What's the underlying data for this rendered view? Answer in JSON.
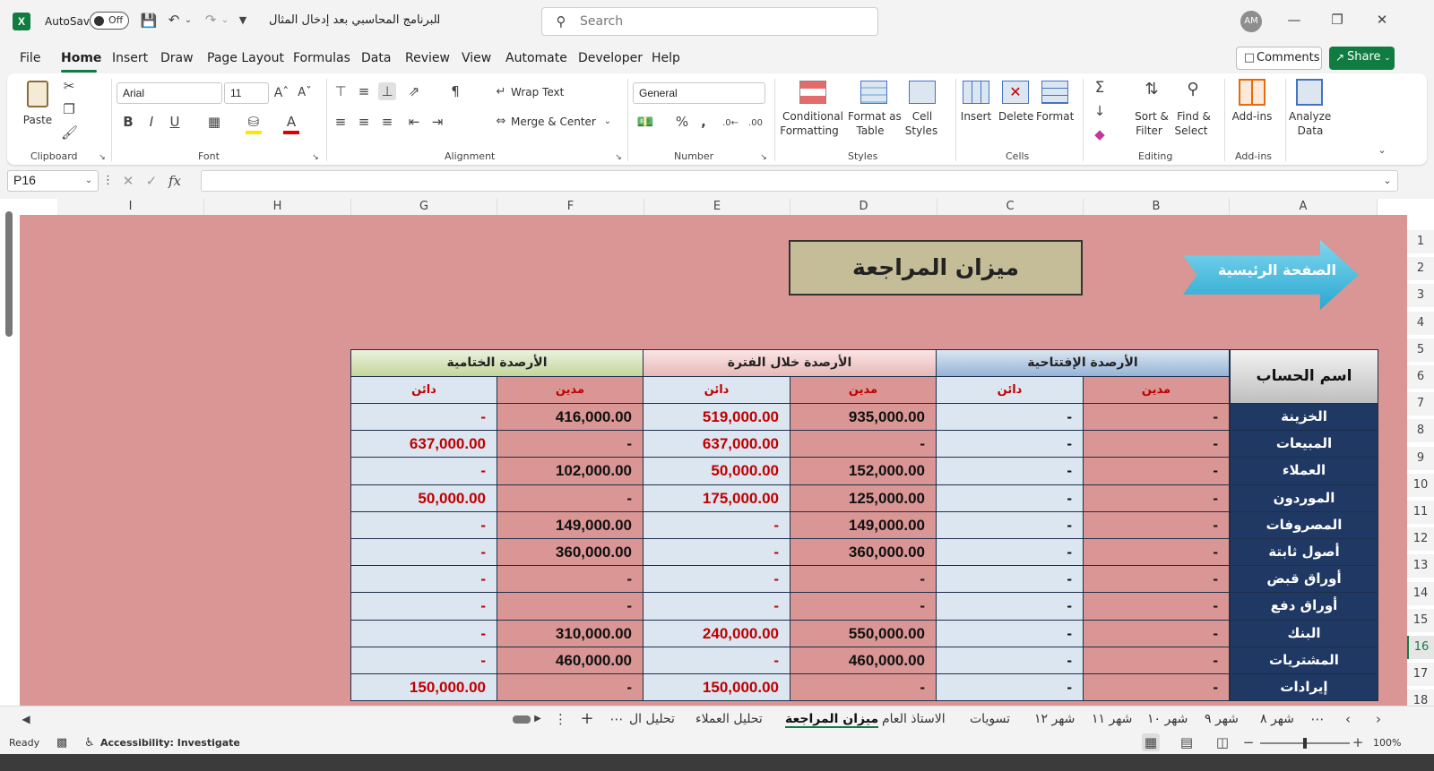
{
  "title_bar": {
    "autosave_label": "AutoSave",
    "autosave_state": "Off",
    "file_name": "البرنامج المحاسبي بعد إدخال المثال",
    "search_placeholder": "Search",
    "avatar_initials": "AM"
  },
  "menu": [
    "File",
    "Home",
    "Insert",
    "Draw",
    "Page Layout",
    "Formulas",
    "Data",
    "Review",
    "View",
    "Automate",
    "Developer",
    "Help"
  ],
  "menu_active": "Home",
  "comments_label": "Comments",
  "share_label": "Share",
  "ribbon": {
    "paste_label": "Paste",
    "clipboard_label": "Clipboard",
    "font_name": "Arial",
    "font_size": "11",
    "font_label": "Font",
    "wrap_text": "Wrap Text",
    "merge_center": "Merge & Center",
    "alignment_label": "Alignment",
    "number_format": "General",
    "number_label": "Number",
    "conditional_formatting_1": "Conditional",
    "conditional_formatting_2": "Formatting",
    "format_table_1": "Format as",
    "format_table_2": "Table",
    "cell_styles_1": "Cell",
    "cell_styles_2": "Styles",
    "styles_label": "Styles",
    "insert": "Insert",
    "delete": "Delete",
    "format": "Format",
    "cells_label": "Cells",
    "sort_filter_1": "Sort &",
    "sort_filter_2": "Filter",
    "find_select_1": "Find &",
    "find_select_2": "Select",
    "editing_label": "Editing",
    "addins": "Add-ins",
    "addins_group_label": "Add-ins",
    "analyze_1": "Analyze",
    "analyze_2": "Data"
  },
  "formula_bar": {
    "name_box": "P16",
    "fx": "fx",
    "formula": ""
  },
  "columns": [
    "I",
    "H",
    "G",
    "F",
    "E",
    "D",
    "C",
    "B",
    "A"
  ],
  "rows": [
    "1",
    "2",
    "3",
    "4",
    "5",
    "6",
    "7",
    "8",
    "9",
    "10",
    "11",
    "12",
    "13",
    "14",
    "15",
    "16",
    "17",
    "18"
  ],
  "sheet": {
    "title": "ميزان المراجعة",
    "home_button": "الصفحة الرئيسية",
    "header_account": "اسم الحساب",
    "group_opening": "الأرصدة الإفتتاحية",
    "group_period": "الأرصدة خلال الفترة",
    "group_closing": "الأرصدة الختامية",
    "debit": "مدين",
    "credit": "دائن",
    "accounts": [
      {
        "name": "الخزينة",
        "open_debit": "-",
        "open_credit": "-",
        "period_debit": "935,000.00",
        "period_credit": "519,000.00",
        "close_debit": "416,000.00",
        "close_credit": "-"
      },
      {
        "name": "المبيعات",
        "open_debit": "-",
        "open_credit": "-",
        "period_debit": "-",
        "period_credit": "637,000.00",
        "close_debit": "-",
        "close_credit": "637,000.00"
      },
      {
        "name": "العملاء",
        "open_debit": "-",
        "open_credit": "-",
        "period_debit": "152,000.00",
        "period_credit": "50,000.00",
        "close_debit": "102,000.00",
        "close_credit": "-"
      },
      {
        "name": "الموردون",
        "open_debit": "-",
        "open_credit": "-",
        "period_debit": "125,000.00",
        "period_credit": "175,000.00",
        "close_debit": "-",
        "close_credit": "50,000.00"
      },
      {
        "name": "المصروفات",
        "open_debit": "-",
        "open_credit": "-",
        "period_debit": "149,000.00",
        "period_credit": "-",
        "close_debit": "149,000.00",
        "close_credit": "-"
      },
      {
        "name": "أصول ثابتة",
        "open_debit": "-",
        "open_credit": "-",
        "period_debit": "360,000.00",
        "period_credit": "-",
        "close_debit": "360,000.00",
        "close_credit": "-"
      },
      {
        "name": "أوراق قبض",
        "open_debit": "-",
        "open_credit": "-",
        "period_debit": "-",
        "period_credit": "-",
        "close_debit": "-",
        "close_credit": "-"
      },
      {
        "name": "أوراق دفع",
        "open_debit": "-",
        "open_credit": "-",
        "period_debit": "-",
        "period_credit": "-",
        "close_debit": "-",
        "close_credit": "-"
      },
      {
        "name": "البنك",
        "open_debit": "-",
        "open_credit": "-",
        "period_debit": "550,000.00",
        "period_credit": "240,000.00",
        "close_debit": "310,000.00",
        "close_credit": "-"
      },
      {
        "name": "المشتريات",
        "open_debit": "-",
        "open_credit": "-",
        "period_debit": "460,000.00",
        "period_credit": "-",
        "close_debit": "460,000.00",
        "close_credit": "-"
      },
      {
        "name": "إيرادات",
        "open_debit": "-",
        "open_credit": "-",
        "period_debit": "-",
        "period_credit": "150,000.00",
        "close_debit": "-",
        "close_credit": "150,000.00"
      }
    ]
  },
  "tabs": [
    "تحليل ال",
    "تحليل العملاء",
    "ميزان المراجعة",
    "الاستاذ العام",
    "تسويات",
    "شهر ١٢",
    "شهر ١١",
    "شهر ١٠",
    "شهر ٩",
    "شهر ٨"
  ],
  "active_tab": "ميزان المراجعة",
  "status": {
    "ready": "Ready",
    "accessibility": "Accessibility: Investigate",
    "zoom": "100%"
  },
  "colors": {
    "sheet_bg": "#d99694",
    "name_col": "#1f3864",
    "excel_green": "#107c41",
    "credit_red": "#c00000"
  }
}
